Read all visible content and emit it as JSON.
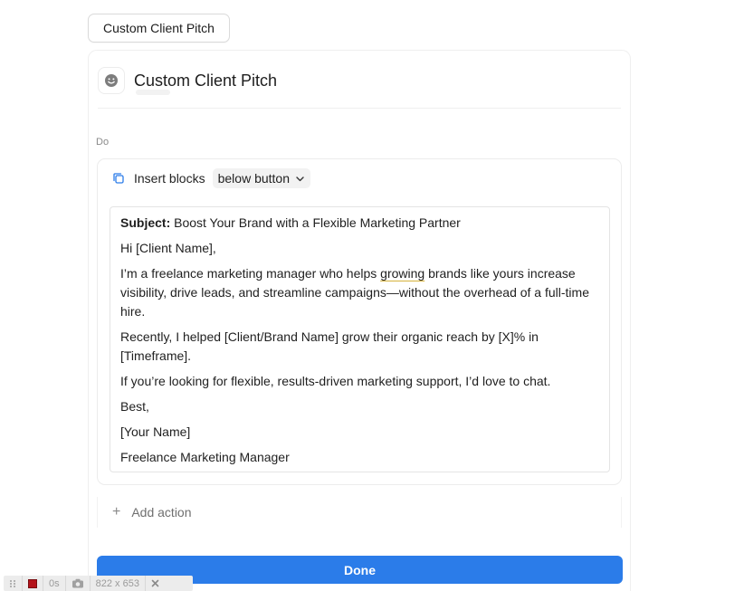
{
  "top_button": {
    "label": "Custom Client Pitch"
  },
  "header": {
    "title": "Custom Client Pitch",
    "icon": "smiley-icon"
  },
  "section_label": "Do",
  "action": {
    "insert_label": "Insert blocks",
    "position_select": "below button",
    "email": {
      "subject_label": "Subject:",
      "subject_text": " Boost Your Brand with a Flexible Marketing Partner",
      "greeting": "Hi [Client Name],",
      "p1_before": "I’m a freelance marketing manager who helps ",
      "p1_underlined": "growing",
      "p1_after": " brands like yours increase visibility, drive leads, and streamline campaigns—without the overhead of a full-time hire.",
      "p2": "Recently, I helped [Client/Brand Name] grow their organic reach by [X]% in [Timeframe].",
      "p3": "If you’re looking for flexible, results-driven marketing support, I’d love to chat.",
      "signoff": "Best,",
      "name": "[Your Name]",
      "role": "Freelance Marketing Manager"
    }
  },
  "add_action_label": "Add action",
  "done_label": "Done",
  "recorder": {
    "timer": "0s",
    "size": "822 x 653"
  },
  "colors": {
    "primary": "#2b7ce9",
    "border": "#ececec"
  }
}
